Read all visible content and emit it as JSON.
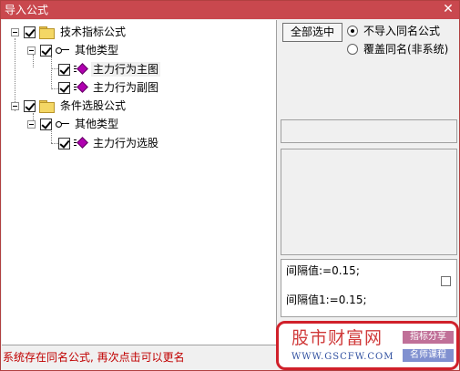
{
  "window": {
    "title": "导入公式",
    "close_glyph": "✕"
  },
  "tree": {
    "group1": {
      "label": "技术指标公式",
      "checked": true
    },
    "group1_sub": {
      "label": "其他类型",
      "checked": true
    },
    "group1_items": [
      {
        "label": "主力行为主图",
        "checked": true
      },
      {
        "label": "主力行为副图",
        "checked": true
      }
    ],
    "group2": {
      "label": "条件选股公式",
      "checked": true
    },
    "group2_sub": {
      "label": "其他类型",
      "checked": true
    },
    "group2_items": [
      {
        "label": "主力行为选股",
        "checked": true
      }
    ]
  },
  "options": {
    "select_all_label": "全部选中",
    "radio_skip_label": "不导入同名公式",
    "radio_overwrite_label": "覆盖同名(非系统)",
    "selected": "skip"
  },
  "formula": {
    "line1": "间隔值:=0.15;",
    "line2": "间隔值1:=0.15;"
  },
  "status": {
    "message": "系统存在同名公式, 再次点击可以更名",
    "color": "#c00000"
  },
  "logo": {
    "brand": "股市财富网",
    "url": "WWW.GSCFW.COM",
    "tag1": "指标分享",
    "tag2": "名师课程"
  },
  "colors": {
    "titlebar": "#c9484e",
    "item_icon": "#b000b0",
    "folder": "#f4d765",
    "logo_border": "#d0202a"
  }
}
